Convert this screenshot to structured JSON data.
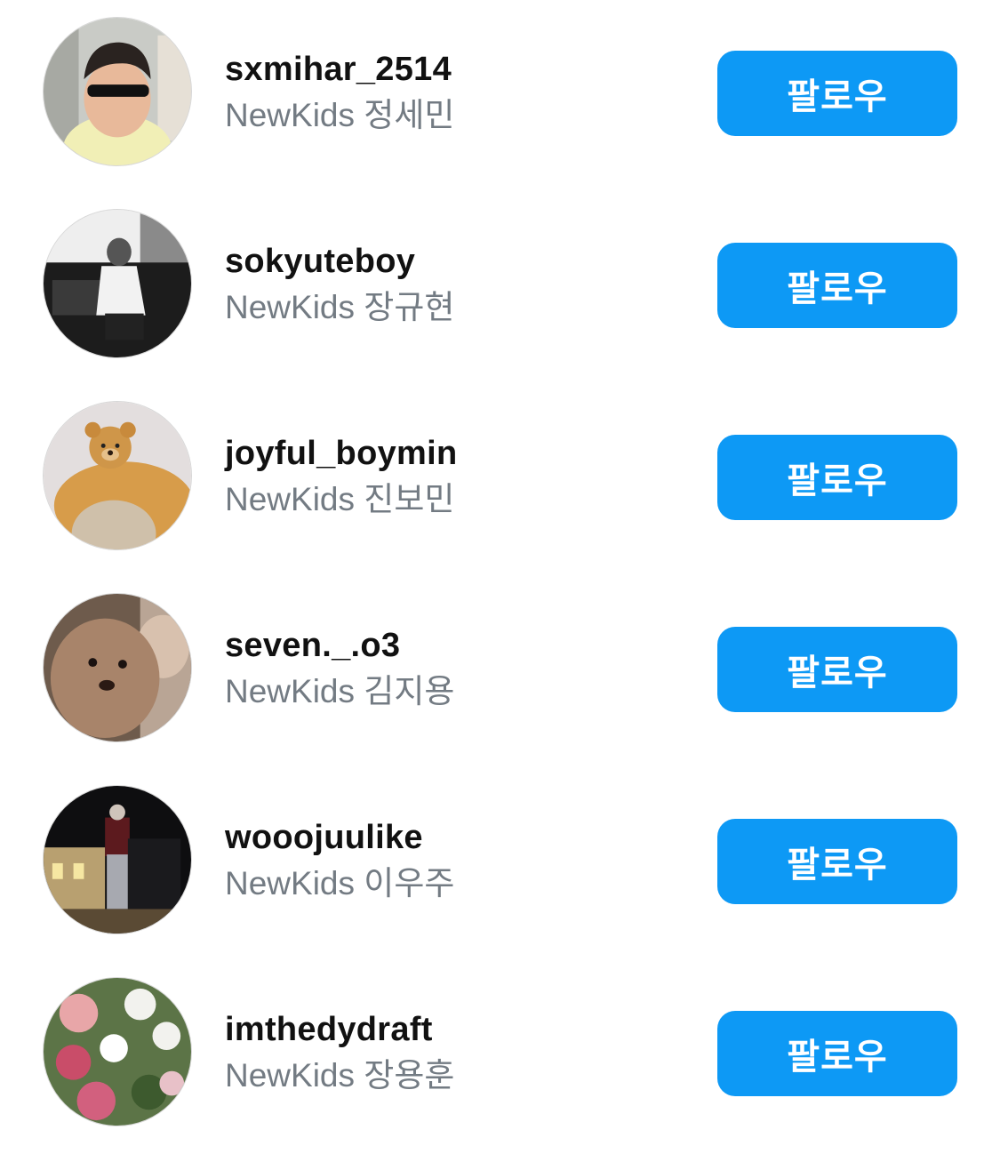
{
  "follow_list": [
    {
      "username": "sxmihar_2514",
      "display_name": "NewKids 정세민",
      "button_label": "팔로우"
    },
    {
      "username": "sokyuteboy",
      "display_name": "NewKids 장규현",
      "button_label": "팔로우"
    },
    {
      "username": "joyful_boymin",
      "display_name": "NewKids 진보민",
      "button_label": "팔로우"
    },
    {
      "username": "seven._.o3",
      "display_name": "NewKids 김지용",
      "button_label": "팔로우"
    },
    {
      "username": "wooojuulike",
      "display_name": "NewKids 이우주",
      "button_label": "팔로우"
    },
    {
      "username": "imthedydraft",
      "display_name": "NewKids 장용훈",
      "button_label": "팔로우"
    }
  ],
  "colors": {
    "follow_button": "#0d99f5",
    "username_text": "#111111",
    "subname_text": "#737b83"
  }
}
